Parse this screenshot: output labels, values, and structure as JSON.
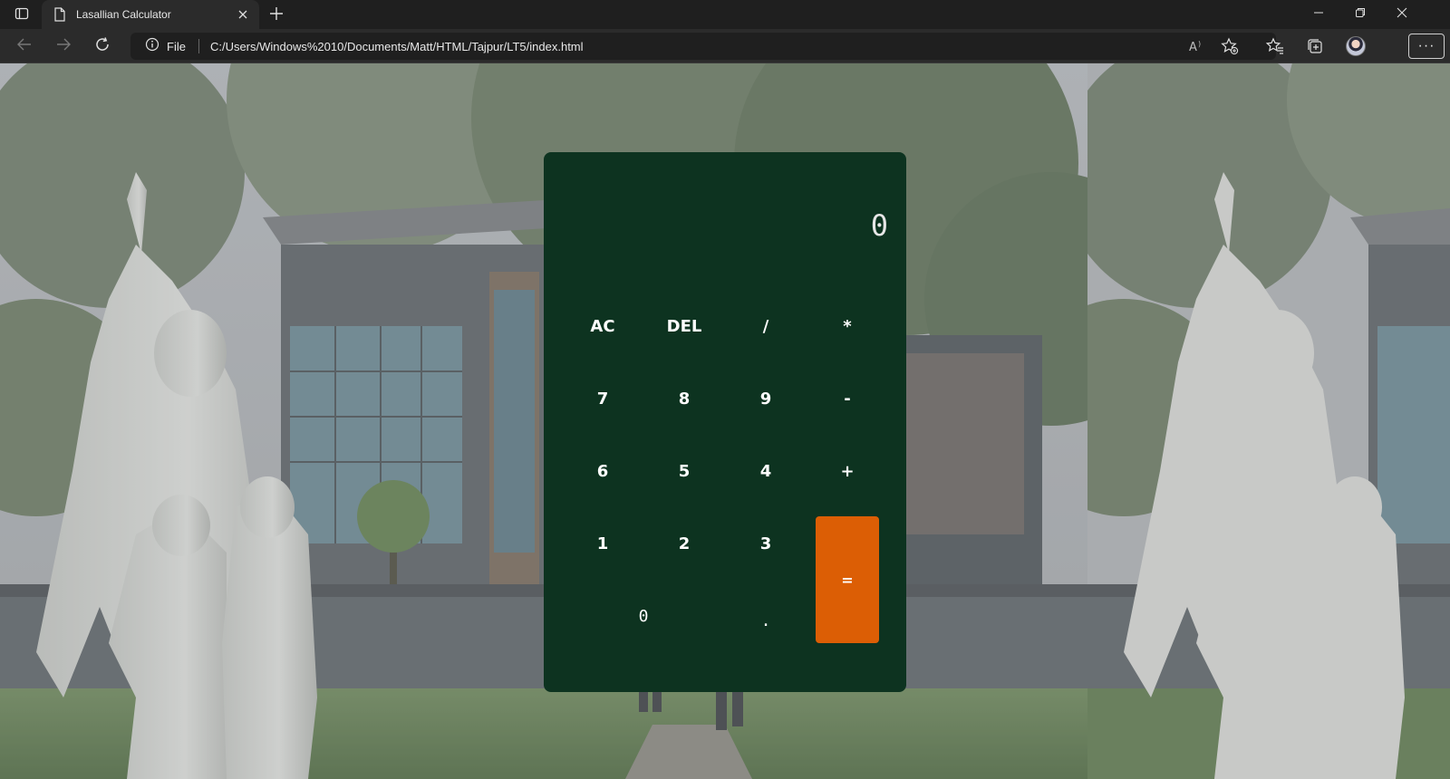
{
  "browser": {
    "tab_title": "Lasallian Calculator",
    "site_info_label": "File",
    "url": "C:/Users/Windows%2010/Documents/Matt/HTML/Tajpur/LT5/index.html",
    "more_label": "···",
    "icons": [
      "tab-actions-icon",
      "page-icon",
      "close-icon",
      "plus-icon",
      "minimize-icon",
      "restore-icon",
      "back-icon",
      "forward-icon",
      "refresh-icon",
      "info-icon",
      "read-aloud-icon",
      "add-favorite-icon",
      "favorites-icon",
      "collections-icon",
      "profile-avatar",
      "more-icon"
    ]
  },
  "calculator": {
    "display_value": "0",
    "keys": {
      "ac": "AC",
      "del": "DEL",
      "divide": "/",
      "multiply": "*",
      "seven": "7",
      "eight": "8",
      "nine": "9",
      "minus": "-",
      "six": "6",
      "five": "5",
      "four": "4",
      "plus": "+",
      "one": "1",
      "two": "2",
      "three": "3",
      "equals": "=",
      "zero": "0",
      "decimal": "."
    }
  },
  "colors": {
    "calculator_bg": "#0d3320",
    "equals_bg": "#dc5e05",
    "browser_bg": "#1f1f1f"
  }
}
